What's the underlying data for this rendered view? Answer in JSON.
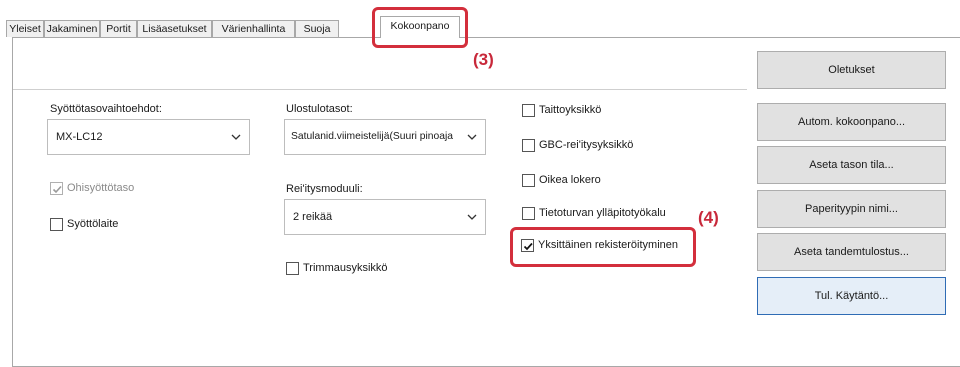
{
  "tabs": [
    {
      "label": "Yleiset"
    },
    {
      "label": "Jakaminen"
    },
    {
      "label": "Portit"
    },
    {
      "label": "Lisäasetukset"
    },
    {
      "label": "Värienhallinta"
    },
    {
      "label": "Suoja"
    },
    {
      "label": "Kokoonpano"
    }
  ],
  "active_tab": "Kokoonpano",
  "annotations": {
    "step3": "(3)",
    "step4": "(4)",
    "color": "#d32f3c"
  },
  "defaults_button": "Oletukset",
  "input_tray": {
    "label": "Syöttötasovaihtoehdot:",
    "value": "MX-LC12"
  },
  "output_tray": {
    "label": "Ulostulotasot:",
    "value": "Satulanid.viimeistelijä(Suuri pinoaja"
  },
  "punch": {
    "label": "Rei'itysmoduuli:",
    "value": "2 reikää"
  },
  "bypass_tray": {
    "label": "Ohisyöttötaso",
    "checked": true,
    "disabled": true
  },
  "feeder": {
    "label": "Syöttölaite",
    "checked": false
  },
  "trimming": {
    "label": "Trimmausyksikkö",
    "checked": false
  },
  "options": [
    {
      "label": "Taittoyksikkö",
      "checked": false
    },
    {
      "label": "GBC-rei'itysyksikkö",
      "checked": false
    },
    {
      "label": "Oikea lokero",
      "checked": false
    },
    {
      "label": "Tietoturvan ylläpitotyökalu",
      "checked": false
    },
    {
      "label": "Yksittäinen rekisteröityminen",
      "checked": true
    }
  ],
  "buttons": [
    {
      "label": "Autom. kokoonpano..."
    },
    {
      "label": "Aseta tason tila..."
    },
    {
      "label": "Paperityypin nimi..."
    },
    {
      "label": "Aseta tandemtulostus..."
    },
    {
      "label": "Tul. Käytäntö..."
    }
  ]
}
